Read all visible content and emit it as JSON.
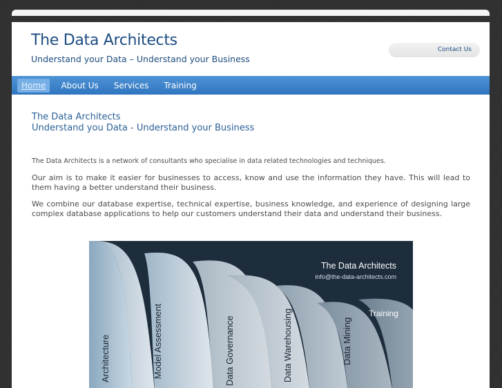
{
  "header": {
    "title": "The Data Architects",
    "tagline": "Understand your Data – Understand your Business",
    "contact_label": "Contact Us"
  },
  "nav": {
    "items": [
      {
        "label": "Home",
        "active": true
      },
      {
        "label": "About Us",
        "active": false
      },
      {
        "label": "Services",
        "active": false
      },
      {
        "label": "Training",
        "active": false
      }
    ]
  },
  "content": {
    "heading_line1": "The Data Architects",
    "heading_line2": "Understand you Data - Understand your Business",
    "paragraph1": "The Data Architects is a network of consultants who specialise in data related technologies and techniques.",
    "paragraph2": "Our aim is to make it easier for businesses to access, know and use the information they have. This will lead to them having a better understand their business.",
    "paragraph3": "We combine our database expertise, technical expertise, business knowledge, and experience of designing large complex database applications to help our customers understand their data and understand their business."
  },
  "banner": {
    "title": "The Data Architects",
    "email": "info@the-data-architects.com",
    "labels": [
      "Architecture",
      "Model Assessment",
      "Data Governance",
      "Data Warehousing",
      "Data Mining",
      "Training"
    ]
  },
  "colors": {
    "nav_blue": "#3a82cc",
    "title_blue": "#1c4c80",
    "background": "#2f2f2f"
  }
}
